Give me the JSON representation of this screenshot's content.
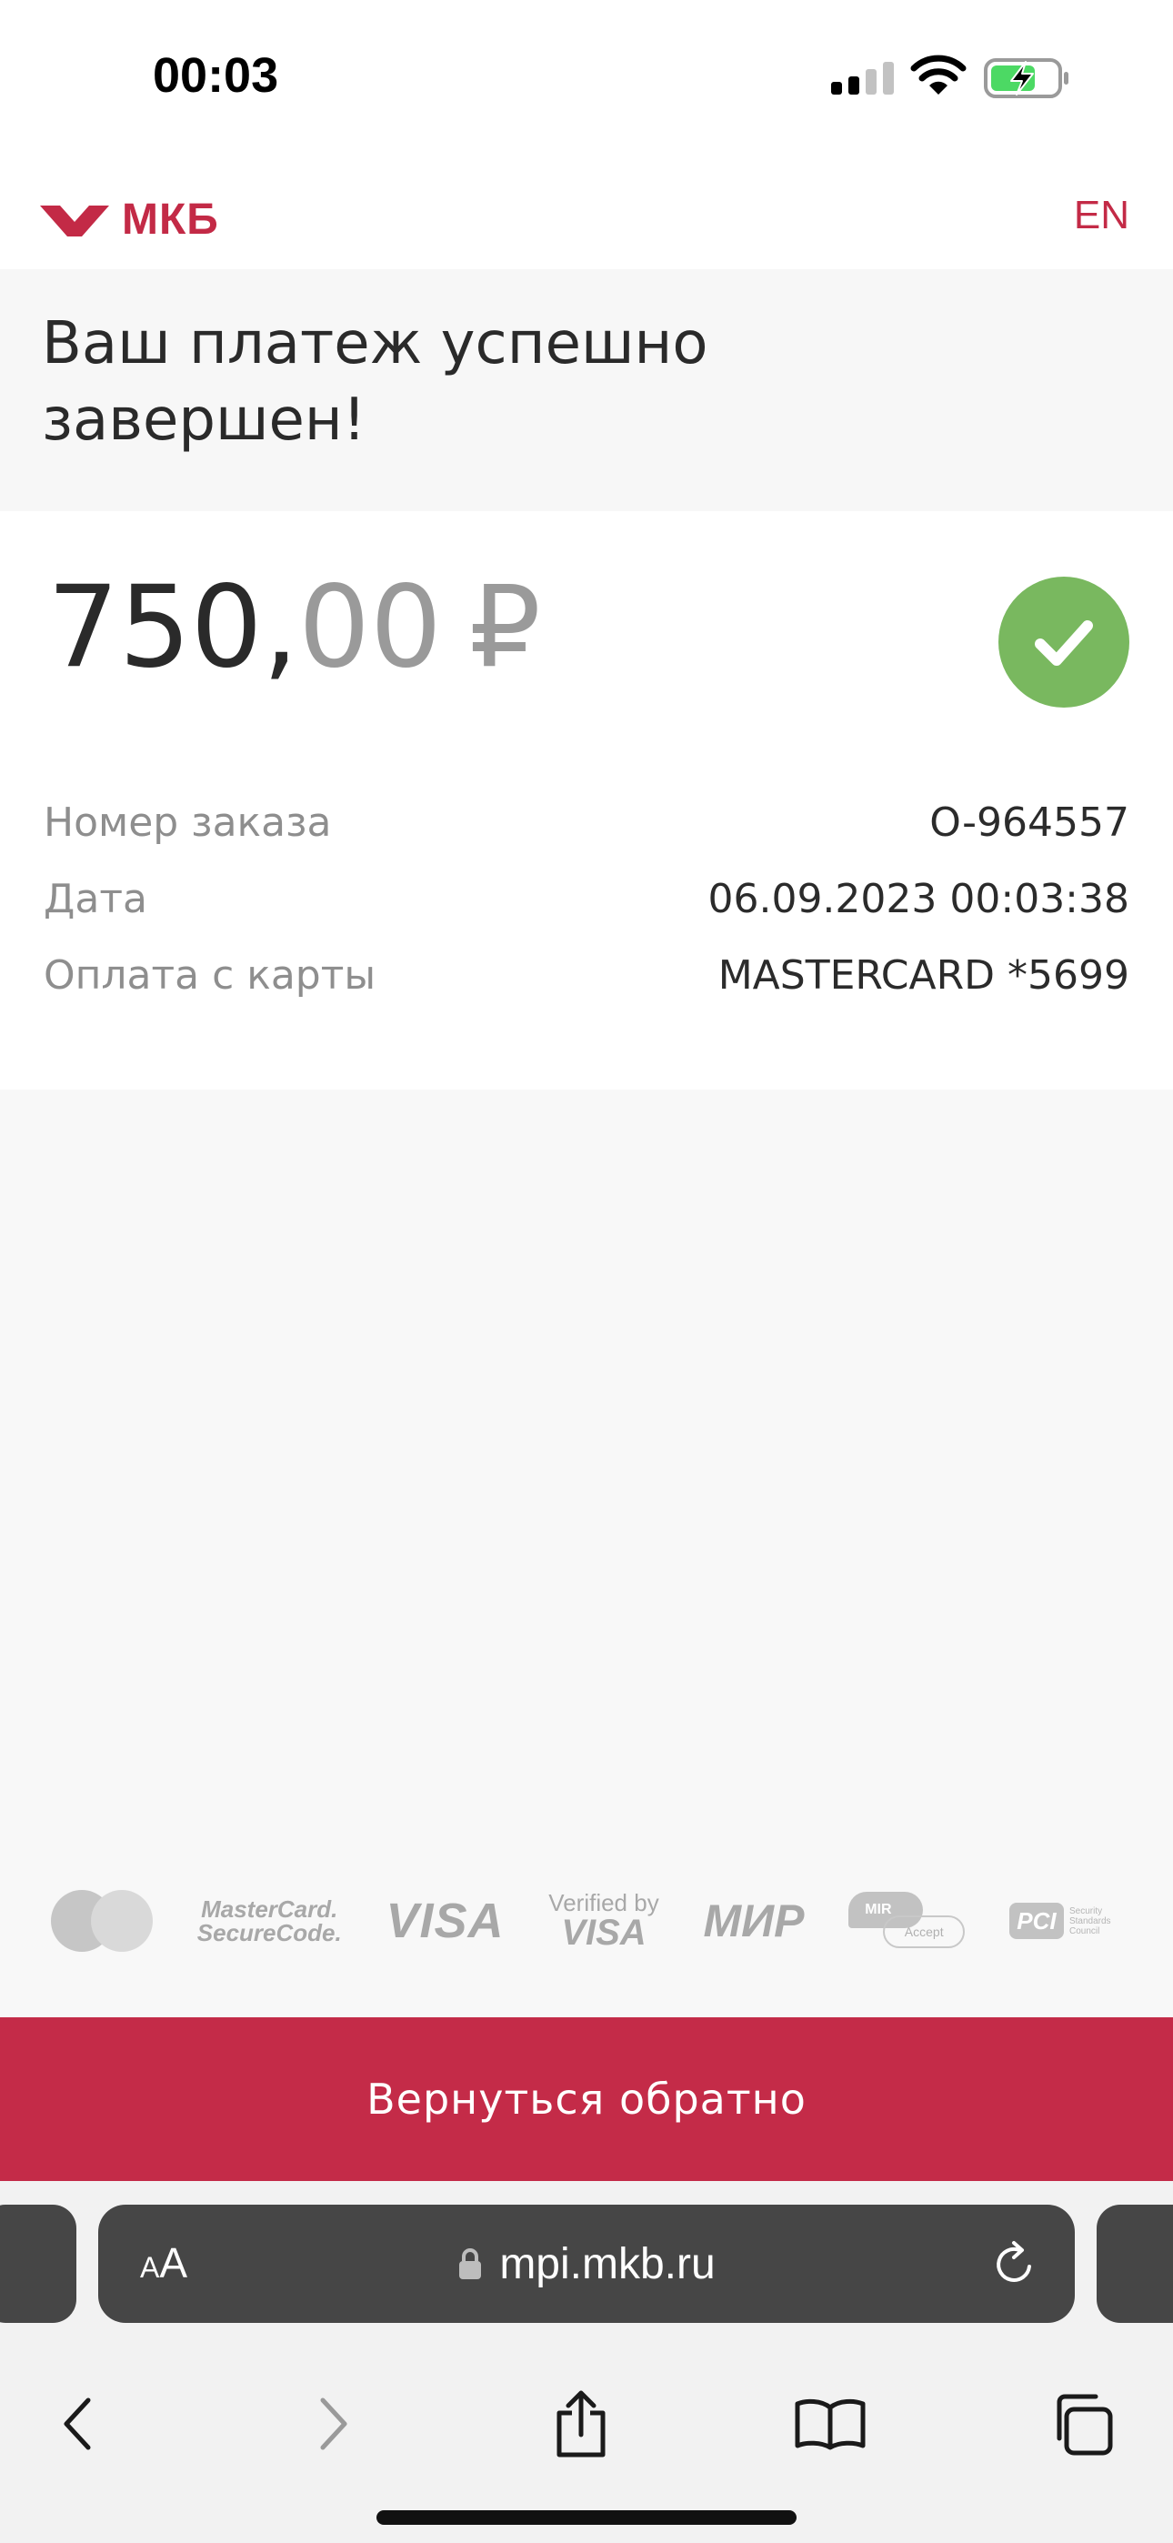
{
  "status_bar": {
    "time": "00:03",
    "icons": [
      "cellular-signal-icon",
      "wifi-icon",
      "battery-charging-icon"
    ]
  },
  "header": {
    "logo_text": "МКБ",
    "language_link": "EN"
  },
  "page": {
    "title": "Ваш платеж успешно завершен!"
  },
  "payment": {
    "amount_integer": "750,",
    "amount_decimal": "00",
    "currency": "₽",
    "status_icon": "checkmark-icon",
    "details": [
      {
        "label": "Номер заказа",
        "value": "O-964557"
      },
      {
        "label": "Дата",
        "value": "06.09.2023 00:03:38"
      },
      {
        "label": "Оплата с карты",
        "value": "MASTERCARD *5699"
      }
    ]
  },
  "payment_systems": {
    "securecode_line1": "MasterCard.",
    "securecode_line2": "SecureCode.",
    "visa": "VISA",
    "verified_line1": "Verified by",
    "verified_line2": "VISA",
    "mir": "МИР",
    "mir_badge": "MIR",
    "mir_accept": "Accept",
    "pci": "PCI",
    "pci_text": "Security Standards Council"
  },
  "actions": {
    "back_label": "Вернуться обратно"
  },
  "browser": {
    "text_size_small": "A",
    "text_size_big": "A",
    "url": "mpi.mkb.ru"
  },
  "colors": {
    "brand": "#c42b48",
    "success": "#79b85f",
    "browser_bar": "#464646"
  }
}
